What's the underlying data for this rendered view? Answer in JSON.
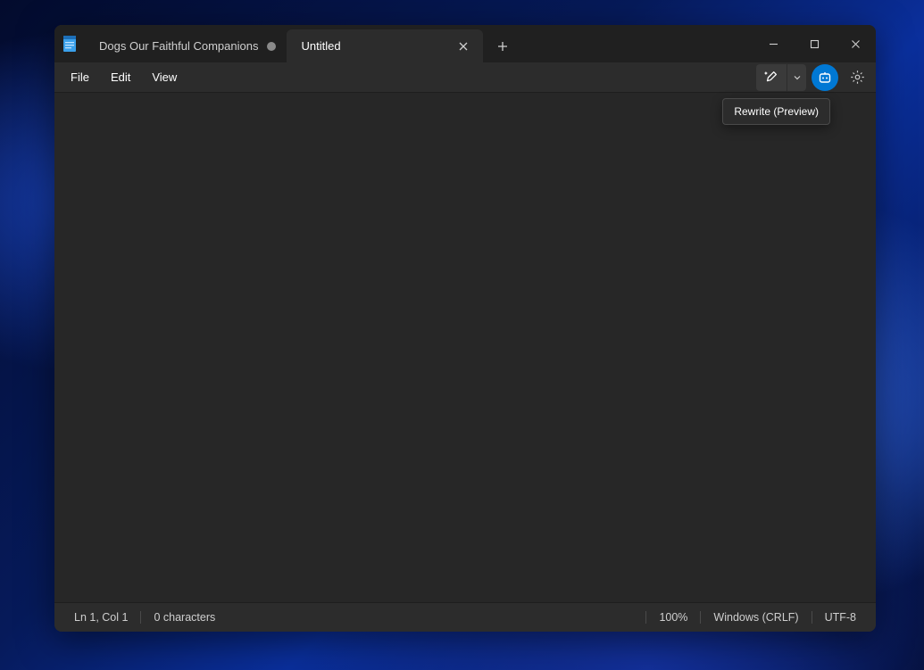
{
  "tabs": [
    {
      "title": "Dogs Our Faithful Companions",
      "modified": true,
      "active": false
    },
    {
      "title": "Untitled",
      "modified": false,
      "active": true
    }
  ],
  "menu": {
    "file": "File",
    "edit": "Edit",
    "view": "View"
  },
  "tooltip": {
    "rewrite": "Rewrite (Preview)"
  },
  "status": {
    "position": "Ln 1, Col 1",
    "chars": "0 characters",
    "zoom": "100%",
    "lineEnding": "Windows (CRLF)",
    "encoding": "UTF-8"
  },
  "editor": {
    "content": ""
  }
}
